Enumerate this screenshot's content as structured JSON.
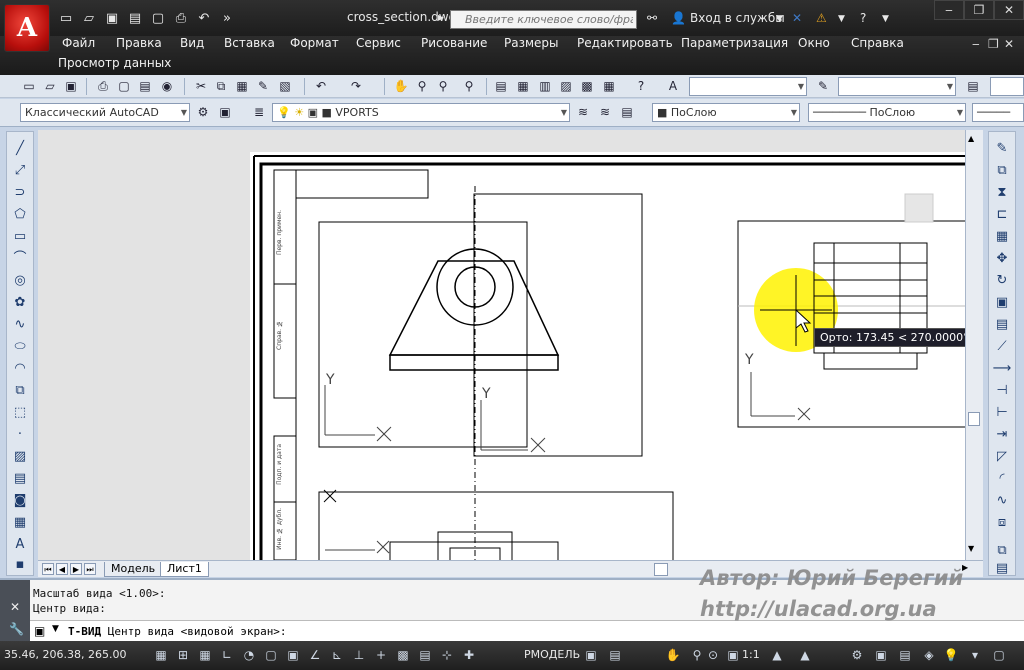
{
  "title_bar": {
    "doc_title": "cross_section.dwg",
    "search_placeholder": "Введите ключевое слово/фразу",
    "login_label": "Вход в службы",
    "logo_letter": "A"
  },
  "menu": {
    "items": [
      "Файл",
      "Правка",
      "Вид",
      "Вставка",
      "Формат",
      "Сервис",
      "Рисование",
      "Размеры",
      "Редактировать",
      "Параметризация",
      "Окно",
      "Справка"
    ],
    "second_row": "Просмотр данных"
  },
  "toolbar": {
    "workspace": "Классический AutoCAD",
    "layer": "VPORTS",
    "color": "ПоСлою",
    "linetype": "ПоСлою"
  },
  "drawing": {
    "tooltip": "Орто: 173.45 < 270.0000°",
    "axis_y": "Y",
    "side_labels": [
      "Перв. примен.",
      "Справ. №",
      "Подп. и дата",
      "Инв. № дубл."
    ]
  },
  "layout_tabs": [
    "Модель",
    "Лист1"
  ],
  "command": {
    "line1": "Масштаб вида <1.00>:",
    "line2": "Центр вида:",
    "prompt_cmd": "Т-ВИД",
    "prompt_rest": " Центр вида <видовой экран>:"
  },
  "watermark": {
    "author": "Автор: Юрий Берегий",
    "url": "http://ulacad.org.ua"
  },
  "status": {
    "coords": "35.46, 206.38, 265.00",
    "space": "РМОДЕЛЬ",
    "scale": "1:1"
  },
  "colors": {
    "title_bg": "#222222",
    "ribbon_bg": "#dfe6ef",
    "highlight": "#fff200"
  }
}
